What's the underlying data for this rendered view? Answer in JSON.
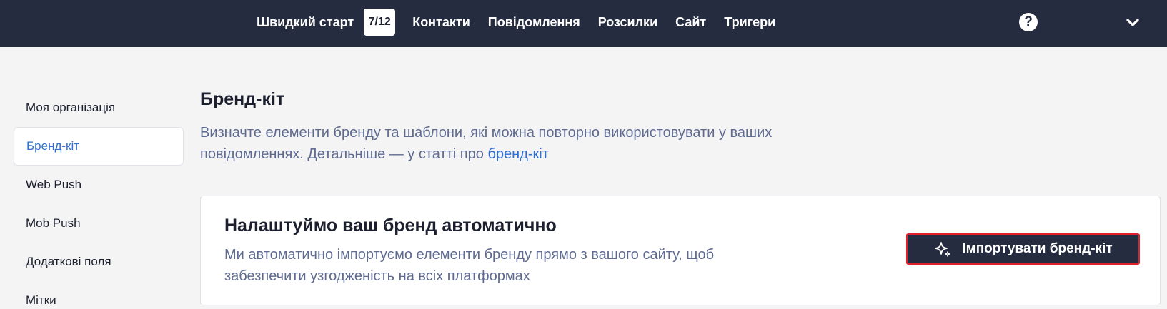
{
  "topnav": {
    "quickstart_label": "Швидкий старт",
    "quickstart_progress": "7/12",
    "items": [
      {
        "label": "Контакти"
      },
      {
        "label": "Повідомлення"
      },
      {
        "label": "Розсилки"
      },
      {
        "label": "Сайт"
      },
      {
        "label": "Тригери"
      }
    ],
    "help_glyph": "?",
    "icons": [
      "help-icon",
      "chevron-down-icon"
    ]
  },
  "sidebar": {
    "items": [
      {
        "label": "Моя організація",
        "active": false
      },
      {
        "label": "Бренд-кіт",
        "active": true
      },
      {
        "label": "Web Push",
        "active": false
      },
      {
        "label": "Mob Push",
        "active": false
      },
      {
        "label": "Додаткові поля",
        "active": false
      },
      {
        "label": "Мітки",
        "active": false
      }
    ]
  },
  "main": {
    "title": "Бренд-кіт",
    "description_line1": "Визначте елементи бренду та шаблони, які можна повторно використовувати у ваших",
    "description_line2": "повідомленнях. Детальніше — у статті про ",
    "description_link": "бренд-кіт"
  },
  "card": {
    "title": "Налаштуймо ваш бренд автоматично",
    "description_line1": "Ми автоматично імпортуємо елементи бренду прямо з вашого сайту, щоб",
    "description_line2": "забезпечити узгодженість на всіх платформах",
    "button_label": "Імпортувати бренд-кіт",
    "button_icon": "sparkle-icon"
  },
  "colors": {
    "header_bg": "#262c40",
    "accent": "#2f6fd3",
    "muted_text": "#5e6a90",
    "highlight_border": "#e0202a"
  }
}
